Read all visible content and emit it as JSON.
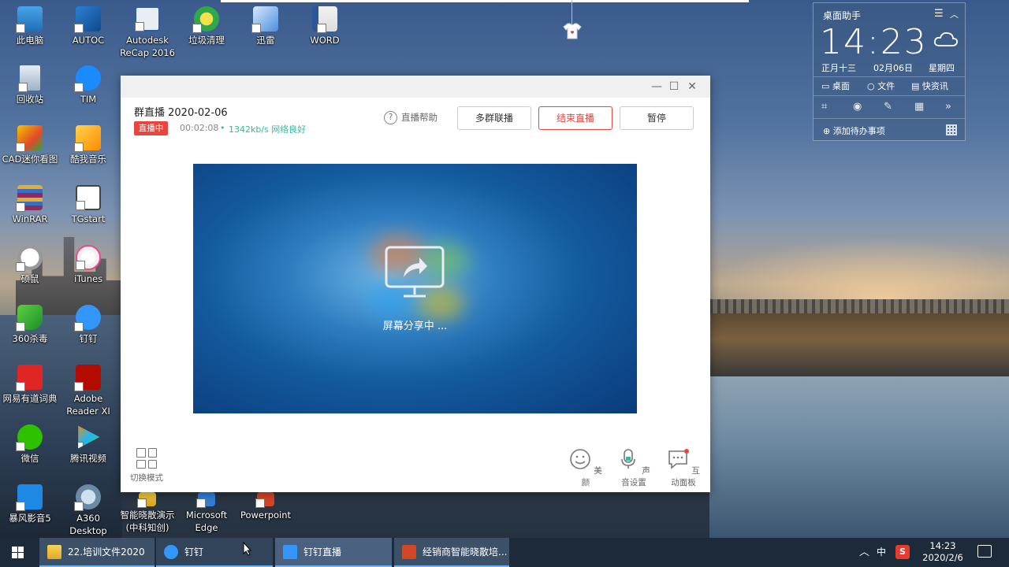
{
  "desktop_icons": [
    {
      "label": "此电脑"
    },
    {
      "label": "AUTOC"
    },
    {
      "label": "Autodesk ReCap 2016"
    },
    {
      "label": "垃圾清理"
    },
    {
      "label": "迅雷"
    },
    {
      "label": "WORD"
    },
    {
      "label": "回收站"
    },
    {
      "label": "TIM"
    },
    {
      "label": "CAD迷你看图"
    },
    {
      "label": "酷我音乐"
    },
    {
      "label": "WinRAR"
    },
    {
      "label": "TGstart"
    },
    {
      "label": "硕鼠"
    },
    {
      "label": "iTunes"
    },
    {
      "label": "360杀毒"
    },
    {
      "label": "钉钉"
    },
    {
      "label": "网易有道词典"
    },
    {
      "label": "Adobe Reader XI"
    },
    {
      "label": "微信"
    },
    {
      "label": "腾讯视频"
    },
    {
      "label": "暴风影音5"
    },
    {
      "label": "A360 Desktop"
    },
    {
      "label": "智能晓散演示(中科知创)"
    },
    {
      "label": "Microsoft Edge"
    },
    {
      "label": "Powerpoint"
    }
  ],
  "widget": {
    "title": "桌面助手",
    "time": "14:23",
    "lunar": "正月十三",
    "date": "02月06日",
    "weekday": "星期四",
    "links": [
      "桌面",
      "文件",
      "快资讯"
    ],
    "add_todo": "添加待办事项"
  },
  "dialog": {
    "title": "群直播 2020-02-06",
    "badge": "直播中",
    "elapsed": "00:02:08",
    "dot": "•",
    "network": "1342kb/s 网络良好",
    "help": "直播帮助",
    "buttons": {
      "multi": "多群联播",
      "end": "结束直播",
      "pause": "暂停"
    },
    "sharing": "屏幕分享中 ...",
    "mode": "切换模式",
    "tools": {
      "beauty": "美颜",
      "sound": "声音设置",
      "interact": "互动面板"
    }
  },
  "taskbar": {
    "tasks": [
      {
        "label": "22.培训文件2020"
      },
      {
        "label": "钉钉"
      },
      {
        "label": "钉钉直播"
      },
      {
        "label": "经销商智能晓散培..."
      }
    ],
    "ime": "中",
    "clock_time": "14:23",
    "clock_date": "2020/2/6"
  },
  "colors": {
    "accent_red": "#e6463c",
    "network_green": "#3ab5a0",
    "taskbar": "#1c2a3a"
  }
}
